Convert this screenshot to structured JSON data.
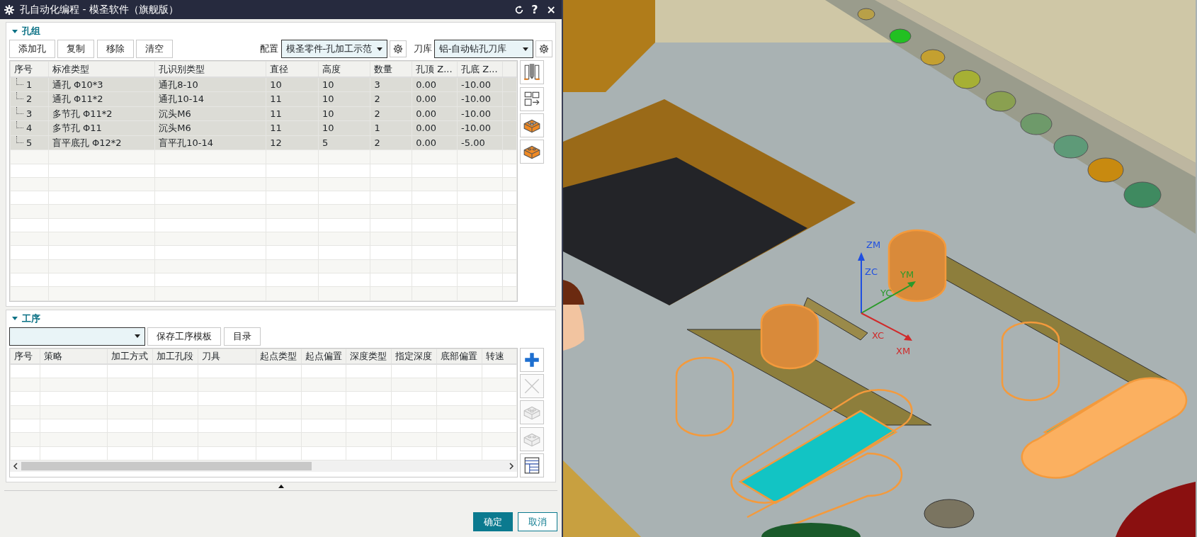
{
  "window": {
    "title": "孔自动化编程 - 模圣软件（旗舰版）",
    "title_buttons": [
      "?",
      "×"
    ]
  },
  "hole_group": {
    "title": "孔组",
    "expanded": true,
    "buttons": [
      "添加孔",
      "复制",
      "移除",
      "清空"
    ],
    "config": {
      "label": "配置",
      "value": "模圣零件-孔加工示范"
    },
    "tool_library": {
      "label": "刀库",
      "value": "铝-自动钻孔刀库"
    },
    "table": {
      "columns": [
        "序号",
        "标准类型",
        "孔识别类型",
        "直径",
        "高度",
        "数量",
        "孔顶 Z...",
        "孔底 Z..."
      ],
      "rows": [
        {
          "cells": [
            "1",
            "通孔 Φ10*3",
            "通孔8-10",
            "10",
            "10",
            "3",
            "0.00",
            "-10.00"
          ],
          "selected": true,
          "focused": false
        },
        {
          "cells": [
            "2",
            "通孔 Φ11*2",
            "通孔10-14",
            "11",
            "10",
            "2",
            "0.00",
            "-10.00"
          ],
          "selected": true,
          "focused": false
        },
        {
          "cells": [
            "3",
            "多节孔 Φ11*2",
            "沉头M6",
            "11",
            "10",
            "2",
            "0.00",
            "-10.00"
          ],
          "selected": true,
          "focused": false
        },
        {
          "cells": [
            "4",
            "多节孔 Φ11",
            "沉头M6",
            "11",
            "10",
            "1",
            "0.00",
            "-10.00"
          ],
          "selected": true,
          "focused": false
        },
        {
          "cells": [
            "5",
            "盲平底孔 Φ12*2",
            "盲平孔10-14",
            "12",
            "5",
            "2",
            "0.00",
            "-5.00"
          ],
          "selected": true,
          "focused": true
        }
      ]
    },
    "side_tools": [
      {
        "kind": "tool"
      },
      {
        "kind": "export"
      },
      {
        "kind": "brick"
      },
      {
        "kind": "brick-open"
      }
    ]
  },
  "operations": {
    "title": "工序",
    "expanded": true,
    "buttons": [
      "保存工序模板",
      "目录"
    ],
    "table": {
      "columns": [
        "序号",
        "策略",
        "加工方式",
        "加工孔段",
        "刀具",
        "起点类型",
        "起点偏置",
        "深度类型",
        "指定深度",
        "底部偏置",
        "转速"
      ]
    },
    "side_tools": [
      {
        "kind": "add",
        "disabled": false
      },
      {
        "kind": "delete",
        "disabled": true
      },
      {
        "kind": "brick",
        "disabled": true
      },
      {
        "kind": "brick-open",
        "disabled": true
      },
      {
        "kind": "table",
        "disabled": false
      }
    ]
  },
  "footer": {
    "buttons": [
      {
        "label": "确定",
        "kind": "primary"
      },
      {
        "label": "取消",
        "kind": "secondary"
      }
    ]
  },
  "viewport": {
    "axis_labels": [
      {
        "label": "ZM",
        "kind": "z"
      },
      {
        "label": "ZC",
        "kind": "z"
      },
      {
        "label": "YM",
        "kind": "y"
      },
      {
        "label": "YC",
        "kind": "y"
      },
      {
        "label": "XC",
        "kind": "x"
      },
      {
        "label": "XM",
        "kind": "x"
      }
    ]
  }
}
